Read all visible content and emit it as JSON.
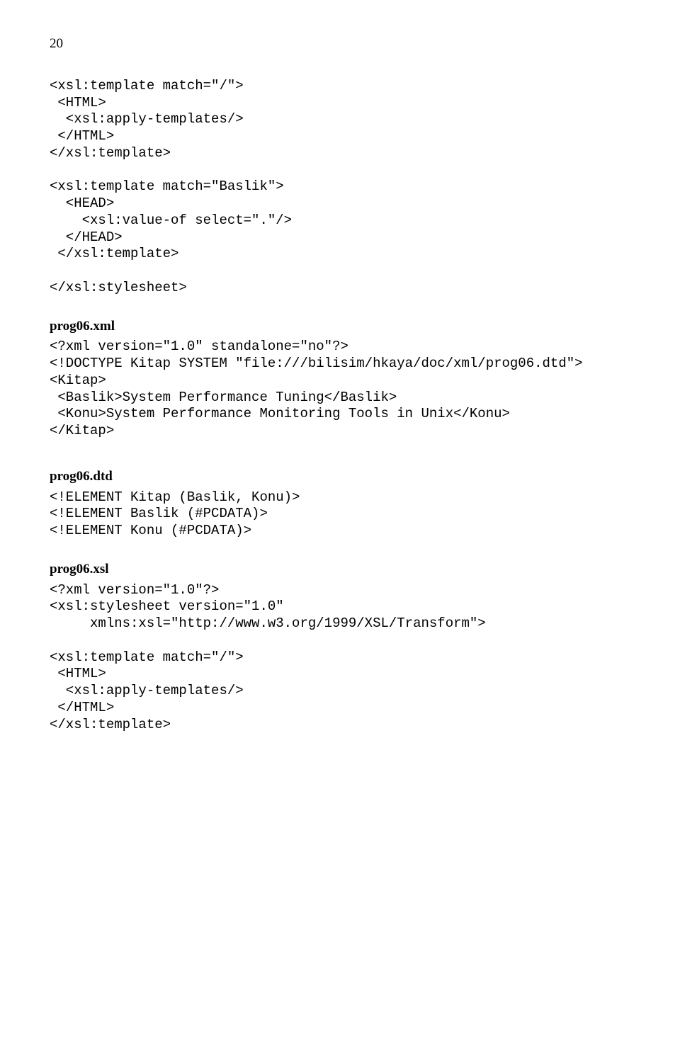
{
  "page_number": "20",
  "code_block_1": "<xsl:template match=\"/\">\n <HTML>\n  <xsl:apply-templates/>\n </HTML>\n</xsl:template>\n\n<xsl:template match=\"Baslik\">\n  <HEAD>\n    <xsl:value-of select=\".\"/>\n  </HEAD>\n </xsl:template>\n\n</xsl:stylesheet>",
  "heading_1": "prog06.xml",
  "code_block_2": "<?xml version=\"1.0\" standalone=\"no\"?>\n<!DOCTYPE Kitap SYSTEM \"file:///bilisim/hkaya/doc/xml/prog06.dtd\">\n<Kitap>\n <Baslik>System Performance Tuning</Baslik>\n <Konu>System Performance Monitoring Tools in Unix</Konu>\n</Kitap>",
  "heading_2": "prog06.dtd",
  "code_block_3": "<!ELEMENT Kitap (Baslik, Konu)>\n<!ELEMENT Baslik (#PCDATA)>\n<!ELEMENT Konu (#PCDATA)>",
  "heading_3": "prog06.xsl",
  "code_block_4": "<?xml version=\"1.0\"?>\n<xsl:stylesheet version=\"1.0\"\n     xmlns:xsl=\"http://www.w3.org/1999/XSL/Transform\">\n\n<xsl:template match=\"/\">\n <HTML>\n  <xsl:apply-templates/>\n </HTML>\n</xsl:template>"
}
